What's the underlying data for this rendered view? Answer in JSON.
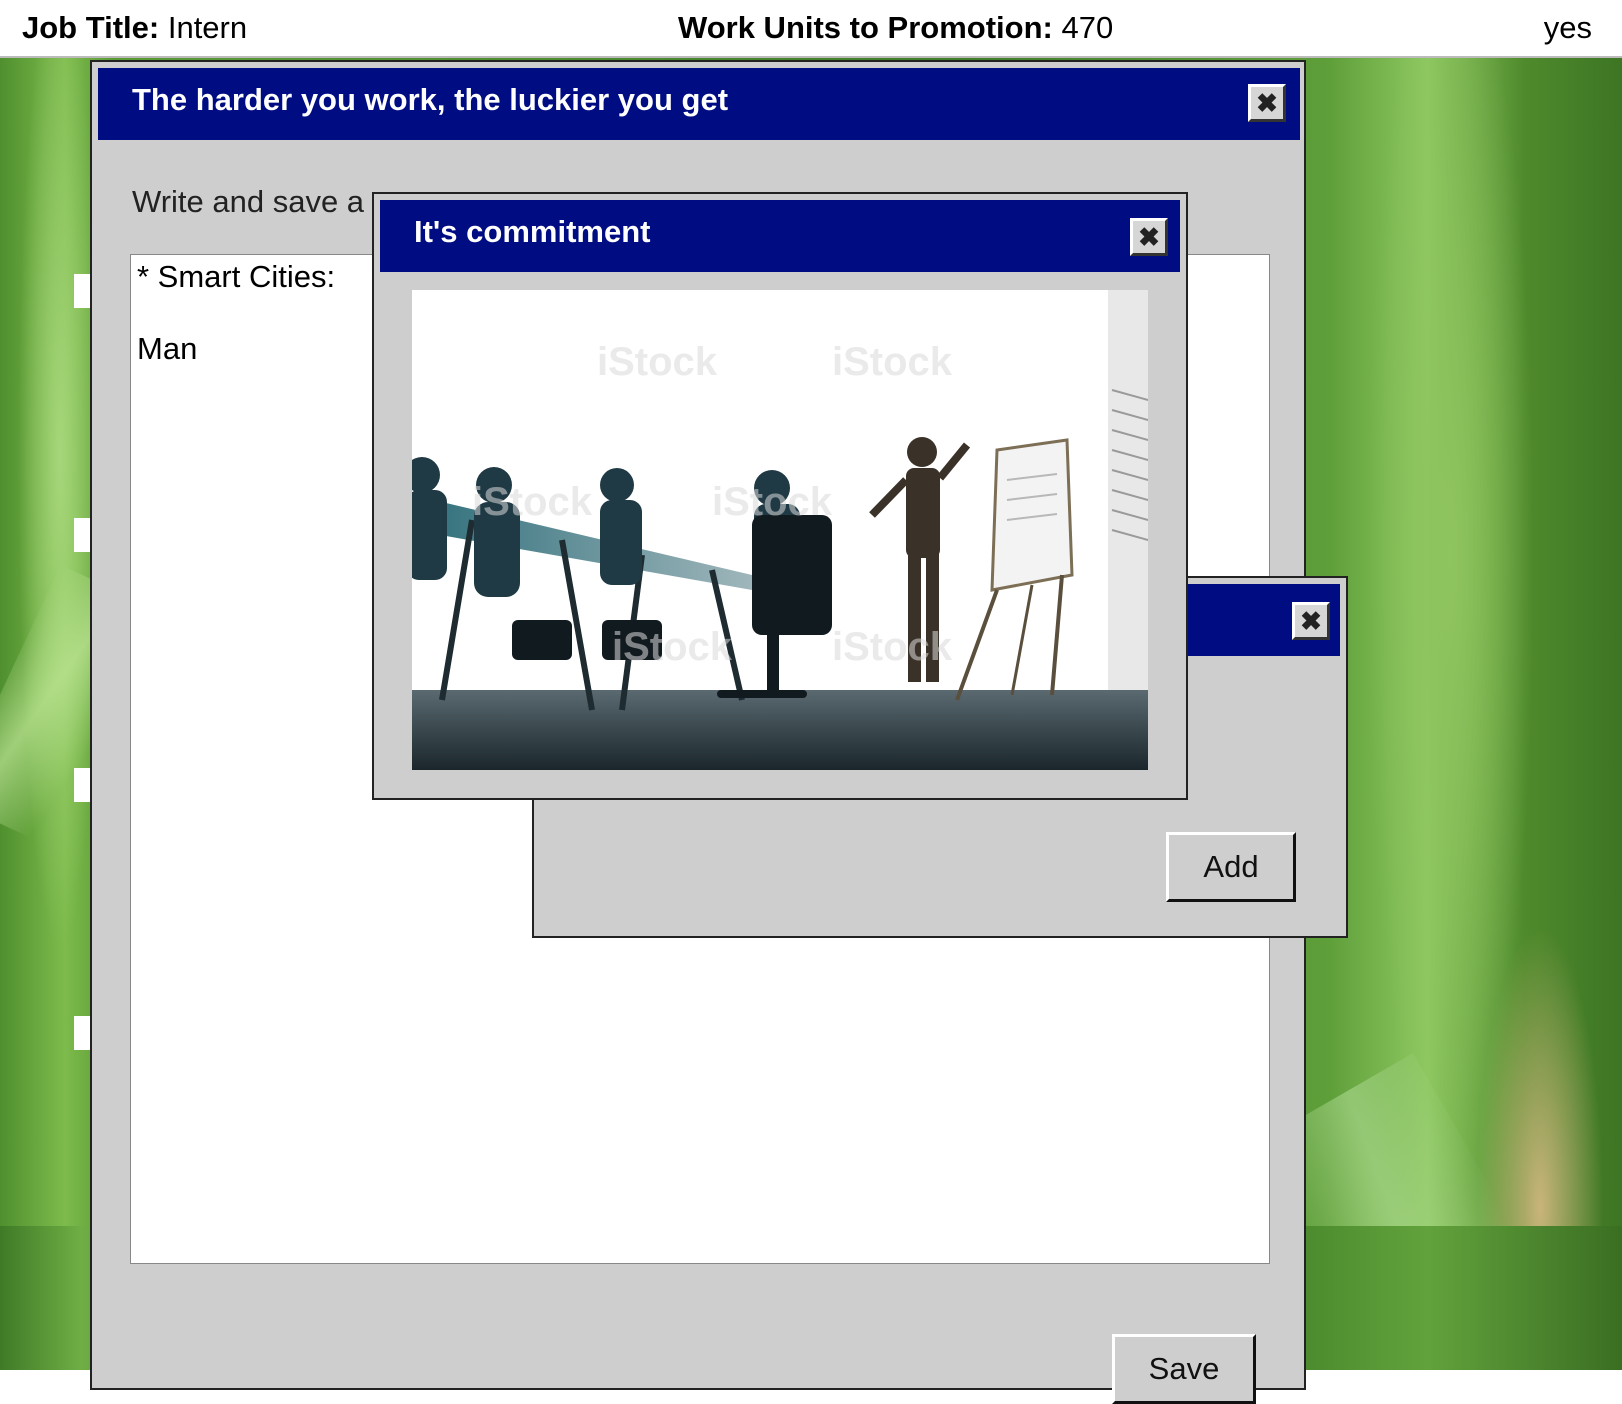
{
  "topbar": {
    "job_label": "Job Title:",
    "job_value": "Intern",
    "units_label": "Work Units to Promotion:",
    "units_value": "470",
    "right_text": "yes"
  },
  "main_window": {
    "title": "The harder you work, the luckier you get",
    "instructions_visible": "Write and save a",
    "text_line1": "* Smart Cities:",
    "text_line2": "Man",
    "save_label": "Save"
  },
  "add_window": {
    "add_label": "Add"
  },
  "commitment_window": {
    "title": "It's commitment"
  },
  "icons": {
    "close": "close-icon"
  },
  "colors": {
    "titlebar": "#000c82",
    "window_bg": "#cecece"
  }
}
